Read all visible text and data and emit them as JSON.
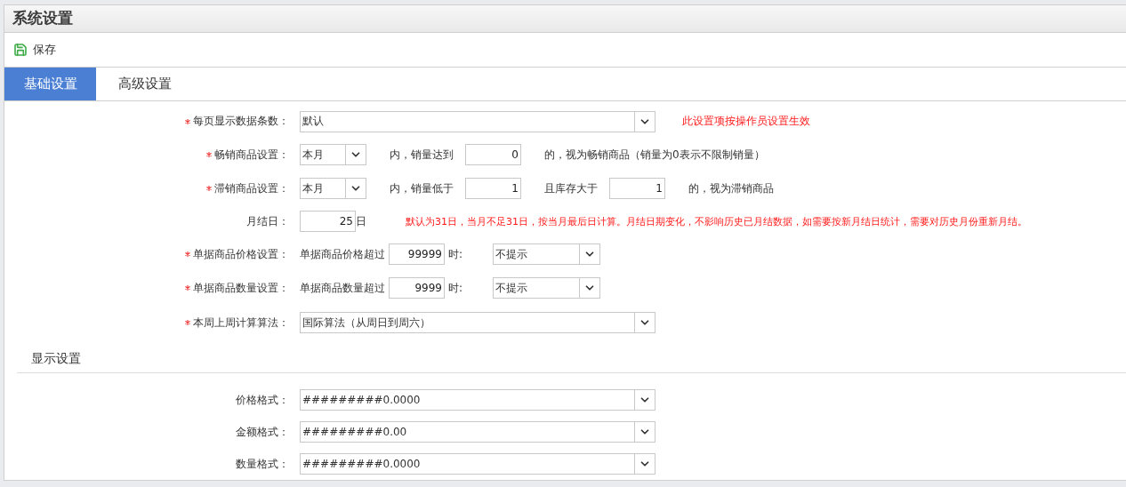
{
  "title": "系统设置",
  "toolbar": [
    {
      "label": "保存"
    }
  ],
  "tabs": [
    {
      "label": "基础设置",
      "selected": true
    },
    {
      "label": "高级设置",
      "selected": false
    }
  ],
  "basic_rows": [
    {
      "label": "每页显示数据条数：",
      "required": true,
      "parts": [
        {
          "kind": "wide-select",
          "value": "默认"
        },
        {
          "kind": "note",
          "text": "此设置项按操作员设置生效"
        }
      ]
    },
    {
      "label": "畅销商品设置：",
      "required": true,
      "parts": [
        {
          "kind": "short-select",
          "value": "本月"
        },
        {
          "kind": "text",
          "text": "内，销量达到"
        },
        {
          "kind": "number",
          "value": "0"
        },
        {
          "kind": "text",
          "text": "的，视为畅销商品（销量为0表示不限制销量）"
        }
      ]
    },
    {
      "label": "滞销商品设置：",
      "required": true,
      "parts": [
        {
          "kind": "short-select",
          "value": "本月"
        },
        {
          "kind": "text",
          "text": "内，销量低于"
        },
        {
          "kind": "number",
          "value": "1"
        },
        {
          "kind": "text",
          "text": "且库存大于"
        },
        {
          "kind": "number",
          "value": "1"
        },
        {
          "kind": "text",
          "text": "的，视为滞销商品"
        }
      ]
    },
    {
      "label": "月结日：",
      "required": false,
      "parts": [
        {
          "kind": "number",
          "value": "25"
        },
        {
          "kind": "tight-text",
          "text": "日"
        },
        {
          "kind": "note",
          "text": "默认为31日，当月不足31日，按当月最后日计算。月结日期变化，不影响历史已月结数据，如需要按新月结日统计，需要对历史月份重新月结。"
        }
      ]
    },
    {
      "label": "单据商品价格设置：",
      "required": true,
      "parts": [
        {
          "kind": "tight-text",
          "text": "单据商品价格超过"
        },
        {
          "kind": "number",
          "value": "99999"
        },
        {
          "kind": "tight-text",
          "text": "时:"
        },
        {
          "kind": "mid-select",
          "value": "不提示"
        }
      ]
    },
    {
      "label": "单据商品数量设置：",
      "required": true,
      "parts": [
        {
          "kind": "tight-text",
          "text": "单据商品数量超过"
        },
        {
          "kind": "number",
          "value": "9999"
        },
        {
          "kind": "tight-text",
          "text": "时:"
        },
        {
          "kind": "mid-select",
          "value": "不提示"
        }
      ]
    },
    {
      "label": "本周上周计算算法：",
      "required": true,
      "parts": [
        {
          "kind": "wide-select",
          "value": "国际算法（从周日到周六）"
        }
      ]
    }
  ],
  "display_section": {
    "heading": "显示设置",
    "rows": [
      {
        "label": "价格格式：",
        "value": "#########0.0000"
      },
      {
        "label": "金额格式：",
        "value": "#########0.00"
      },
      {
        "label": "数量格式：",
        "value": "#########0.0000"
      }
    ]
  }
}
